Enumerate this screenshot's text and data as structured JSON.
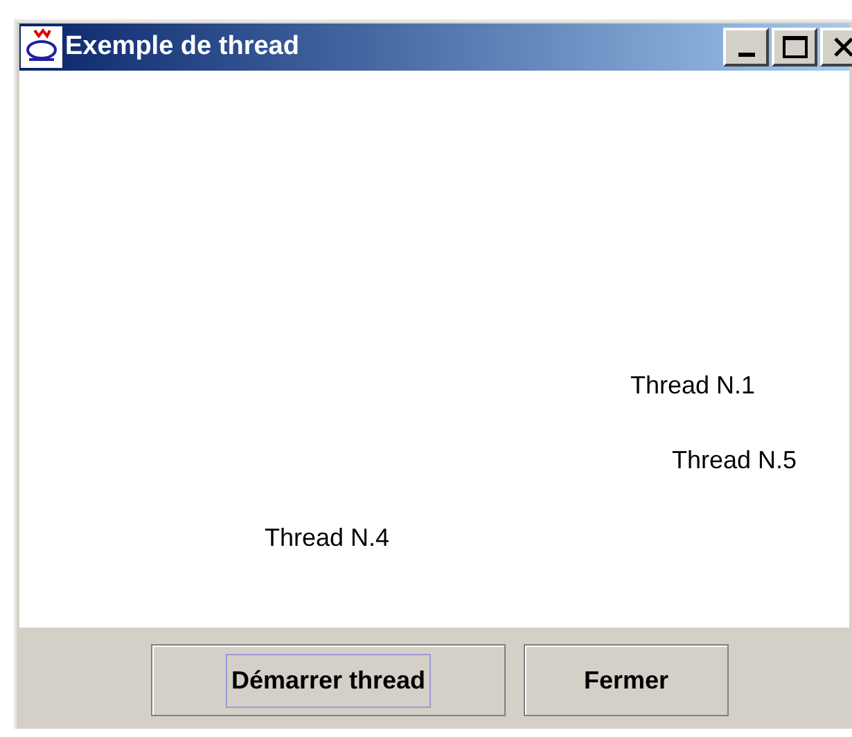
{
  "window": {
    "title": "Exemple de thread"
  },
  "labels": [
    "Thread N.1",
    "Thread N.5",
    "Thread N.4"
  ],
  "buttons": [
    {
      "label": "Démarrer thread",
      "focused": true
    },
    {
      "label": "Fermer",
      "focused": false
    }
  ]
}
